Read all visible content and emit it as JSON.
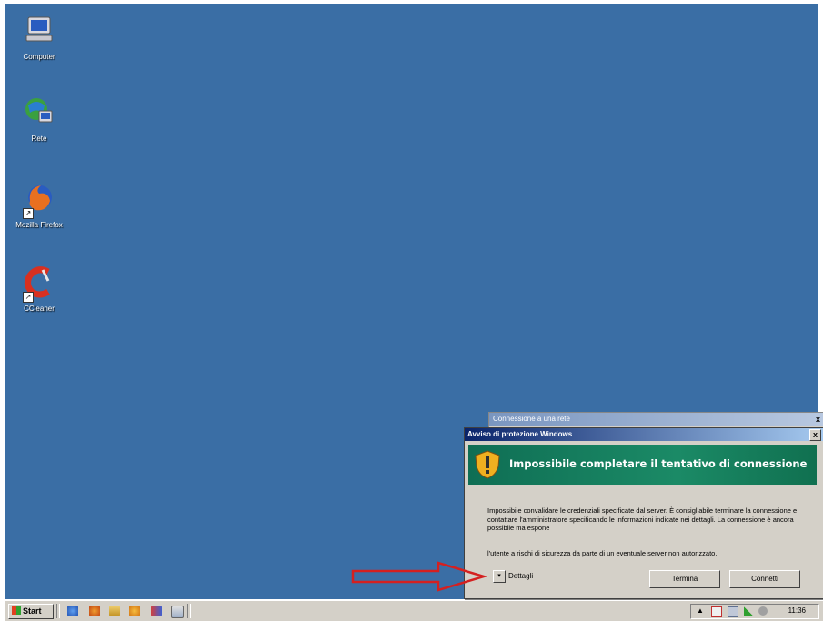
{
  "desktop": {
    "icons": [
      {
        "label": "Computer",
        "icon": "computer-icon"
      },
      {
        "label": "Rete",
        "icon": "network-icon"
      },
      {
        "label": "Mozilla Firefox",
        "icon": "firefox-icon"
      },
      {
        "label": "CCleaner",
        "icon": "ccleaner-icon"
      }
    ],
    "background_color": "#3a6ea5"
  },
  "background_dialog": {
    "title": "Connessione a una rete",
    "close_label": "x"
  },
  "dialog": {
    "title": "Avviso di protezione Windows",
    "close_label": "x",
    "banner_title": "Impossibile completare il tentativo di connessione",
    "message": "Impossibile convalidare le credenziali specificate dal server. È consigliabile terminare la connessione e contattare l'amministratore specificando le informazioni indicate nei dettagli. La connessione è ancora possibile ma espone",
    "message2": "l'utente a rischi di sicurezza da parte di un eventuale server non autorizzato.",
    "details_toggle": "▾",
    "details_label": "Dettagli",
    "terminate_label": "Termina",
    "connect_label": "Connetti",
    "banner_color": "#1b8a66"
  },
  "taskbar": {
    "start_label": "Start",
    "quick_launch": [
      "ie-icon",
      "firefox-icon",
      "folder-icon",
      "media-icon",
      "chart-icon",
      "window-icon"
    ],
    "clock": "11:36",
    "tray_icons": [
      "arrow-icon",
      "shield-alert-icon",
      "network-icon",
      "signal-icon",
      "volume-icon"
    ]
  },
  "annotation": {
    "arrow_color": "#d42020"
  }
}
